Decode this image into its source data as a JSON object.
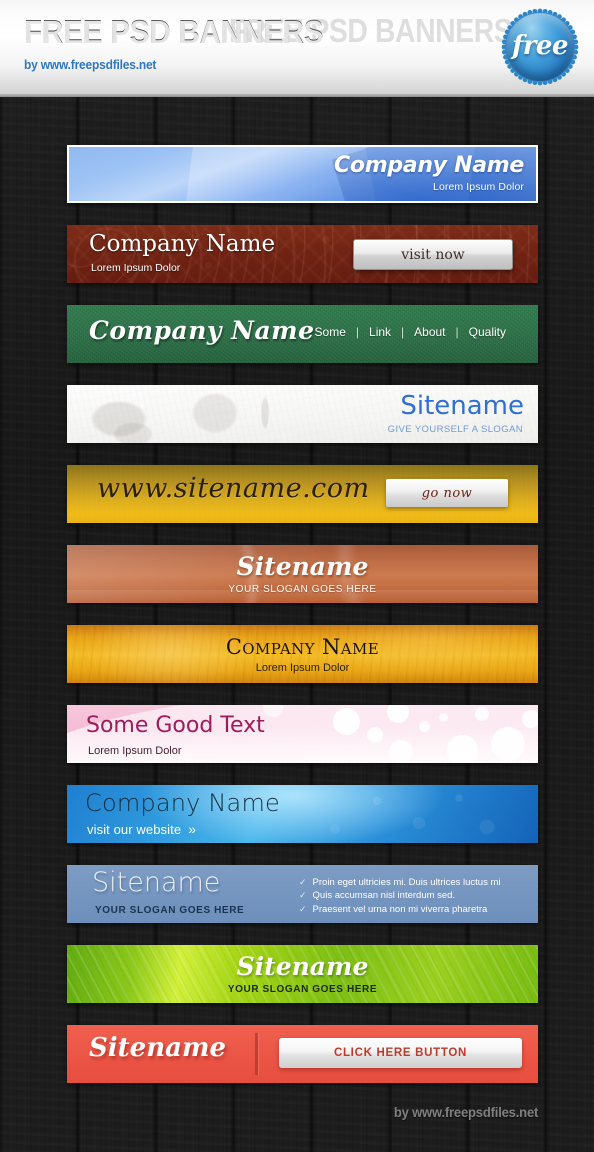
{
  "header": {
    "title": "FREE PSD BANNERS",
    "ghost_title": "FREE PSD BANNERS",
    "subtitle": "by www.freepsdfiles.net",
    "badge_label": "free",
    "badge_color": "#2e86c8"
  },
  "banners": [
    {
      "id": "blue-abstract",
      "name": "Company Name",
      "slogan": "Lorem Ipsum Dolor",
      "accent": "#3f7fe0"
    },
    {
      "id": "dark-red-damask",
      "name": "Company Name",
      "slogan": "Lorem Ipsum Dolor",
      "button": "visit now",
      "accent": "#702313"
    },
    {
      "id": "green-felt",
      "name": "Company Name",
      "nav": [
        "Some",
        "Link",
        "About",
        "Quality"
      ],
      "nav_separator": "|",
      "accent": "#2a6e45"
    },
    {
      "id": "white-paper",
      "name": "Sitename",
      "slogan": "GIVE YOURSELF A SLOGAN",
      "accent": "#2f6fd8"
    },
    {
      "id": "gold-script",
      "name": "www.sitename.com",
      "button": "go now",
      "accent": "#dcae1e"
    },
    {
      "id": "orange-glossy",
      "name": "Sitename",
      "slogan": "YOUR SLOGAN GOES HERE",
      "accent": "#cc7a4f"
    },
    {
      "id": "golden-grunge",
      "name": "Company Name",
      "slogan": "Lorem Ipsum Dolor",
      "accent": "#f3bc27"
    },
    {
      "id": "pink-bokeh",
      "name": "Some Good Text",
      "slogan": "Lorem Ipsum Dolor",
      "accent": "#a01a5c"
    },
    {
      "id": "blue-gradient",
      "name": "Company Name",
      "slogan": "visit our website",
      "arrow": "»",
      "accent": "#2f9ade"
    },
    {
      "id": "steel-blue-list",
      "name": "Sitename",
      "slogan": "YOUR SLOGAN GOES HERE",
      "check": "✓",
      "list": [
        "Proin eget ultricies mi. Duis ultrices luctus mi",
        "Quis accumsan nisl interdum sed.",
        "Praesent vel urna non mi viverra pharetra"
      ],
      "accent": "#7596c0"
    },
    {
      "id": "green-leaf",
      "name": "Sitename",
      "slogan": "YOUR SLOGAN GOES HERE",
      "accent": "#a6d615"
    },
    {
      "id": "red-button",
      "name": "Sitename",
      "button": "CLICK HERE  BUTTON",
      "accent": "#ec5646"
    }
  ],
  "footer": {
    "credit": "by www.freepsdfiles.net"
  }
}
